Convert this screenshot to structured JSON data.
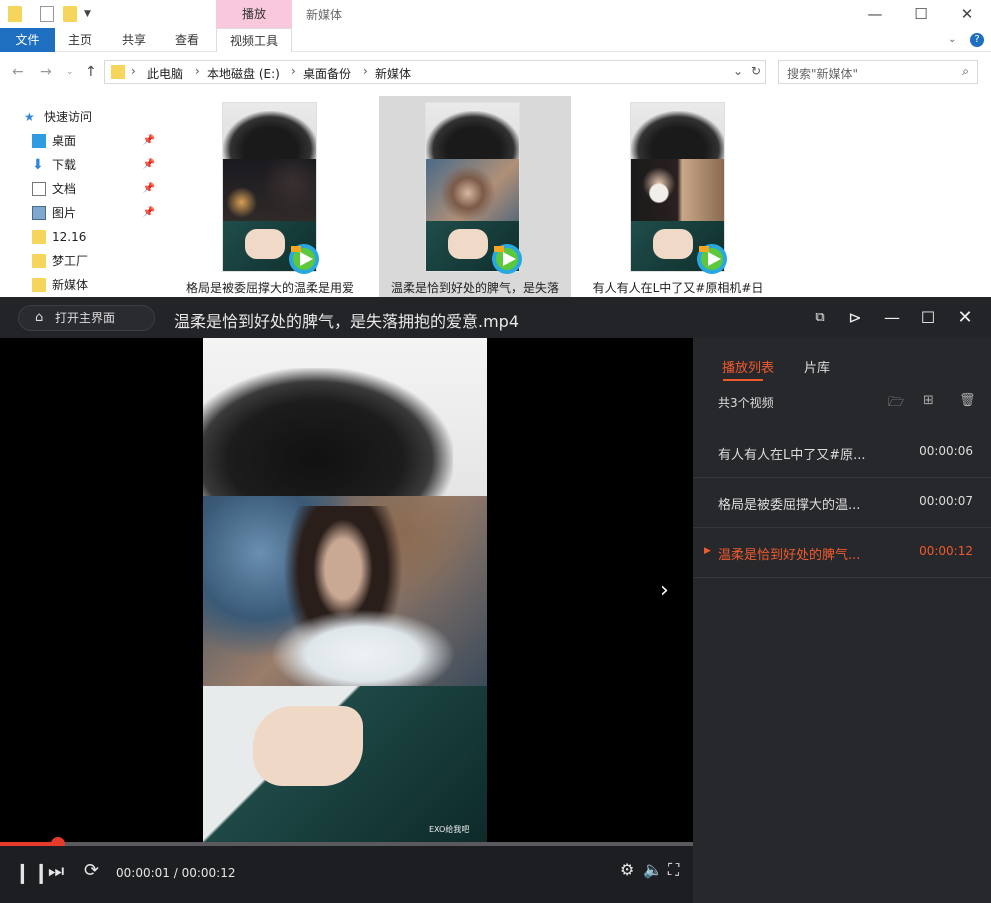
{
  "explorer": {
    "context_tab": "播放",
    "title": "新媒体",
    "ribbon": {
      "file": "文件",
      "home": "主页",
      "share": "共享",
      "view": "查看",
      "video_tools": "视频工具"
    },
    "breadcrumb": [
      "此电脑",
      "本地磁盘 (E:)",
      "桌面备份",
      "新媒体"
    ],
    "search_placeholder": "搜索\"新媒体\"",
    "sidebar": {
      "quick_access": "快速访问",
      "items": [
        {
          "label": "桌面",
          "icon": "desktop-icon",
          "pinned": true
        },
        {
          "label": "下载",
          "icon": "download-icon",
          "pinned": true
        },
        {
          "label": "文档",
          "icon": "document-icon",
          "pinned": true
        },
        {
          "label": "图片",
          "icon": "picture-icon",
          "pinned": true
        },
        {
          "label": "12.16",
          "icon": "folder-icon",
          "pinned": false
        },
        {
          "label": "梦工厂",
          "icon": "folder-icon",
          "pinned": false
        },
        {
          "label": "新媒体",
          "icon": "folder-icon",
          "pinned": false
        }
      ]
    },
    "files": [
      {
        "name": "格局是被委屈撑大的温柔是用爱"
      },
      {
        "name": "温柔是恰到好处的脾气，是失落"
      },
      {
        "name": "有人有人在L中了又#原相机#日"
      }
    ]
  },
  "player": {
    "home_button": "打开主界面",
    "title": "温柔是恰到好处的脾气，是失落拥抱的爱意.mp4",
    "time": "00:00:01 / 00:00:12",
    "progress": 0.083,
    "watermark": "EXO给我吧",
    "panel": {
      "tab_playlist": "播放列表",
      "tab_library": "片库",
      "count": "共3个视频",
      "items": [
        {
          "name": "有人有人在L中了又#原...",
          "duration": "00:00:06",
          "active": false
        },
        {
          "name": "格局是被委屈撑大的温...",
          "duration": "00:00:07",
          "active": false
        },
        {
          "name": "温柔是恰到好处的脾气...",
          "duration": "00:00:12",
          "active": true
        }
      ]
    },
    "colors": {
      "accent": "#ef5a2d",
      "progress": "#e53a2c"
    }
  }
}
